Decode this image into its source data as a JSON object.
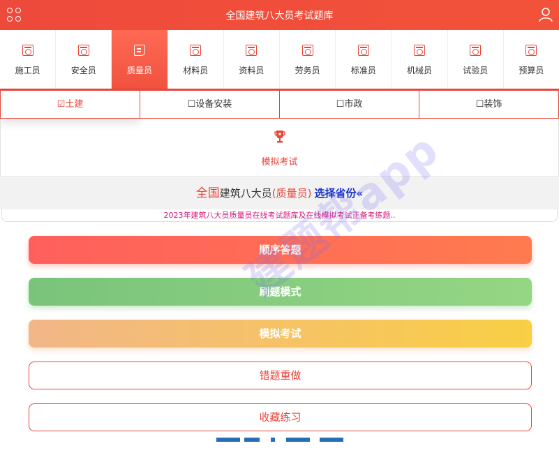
{
  "header": {
    "title": "全国建筑八大员考试题库",
    "menu_icon": "grid-icon",
    "user_icon": "user-icon"
  },
  "roles": [
    {
      "label": "施工员"
    },
    {
      "label": "安全员"
    },
    {
      "label": "质量员",
      "active": true
    },
    {
      "label": "材料员"
    },
    {
      "label": "资料员"
    },
    {
      "label": "劳务员"
    },
    {
      "label": "标准员"
    },
    {
      "label": "机械员"
    },
    {
      "label": "试验员"
    },
    {
      "label": "预算员"
    }
  ],
  "categories": [
    {
      "label": "☑土建",
      "selected": true
    },
    {
      "label": "☐设备安装"
    },
    {
      "label": "☐市政"
    },
    {
      "label": "☐装饰"
    }
  ],
  "mock_exam": {
    "label": "模拟考试",
    "icon": "trophy-icon"
  },
  "province": {
    "prefix": "全国",
    "middle": "建筑八大员",
    "role": "(质量员)",
    "select": "选择省份«"
  },
  "notice": "2023年建筑八大员质量员在线考试题库及在线模拟考试正备考练题..",
  "buttons": {
    "sequential": "顺序答题",
    "drill": "刷题模式",
    "mock": "模拟考试",
    "mistakes": "错题重做",
    "favorites": "收藏练习"
  },
  "watermark": "建题帮app",
  "colors": {
    "accent": "#e8453a",
    "link": "#1a33cc",
    "notice": "#d1187a"
  }
}
